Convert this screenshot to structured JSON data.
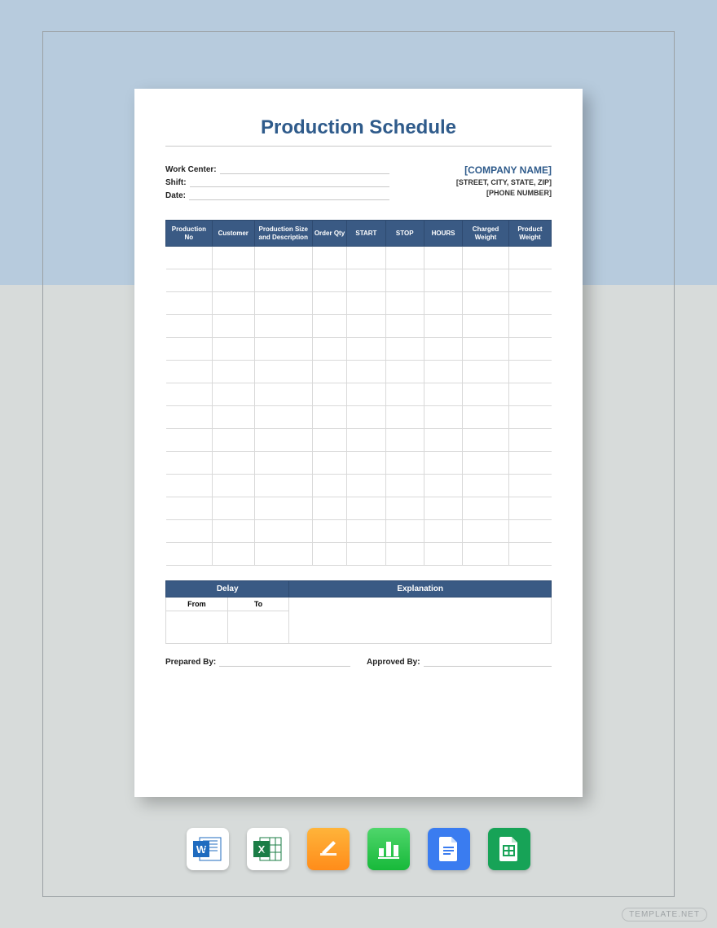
{
  "title": "Production Schedule",
  "header": {
    "left": {
      "work_center_label": "Work Center:",
      "shift_label": "Shift:",
      "date_label": "Date:"
    },
    "right": {
      "company": "[COMPANY NAME]",
      "address": "[STREET, CITY, STATE, ZIP]",
      "phone": "[PHONE NUMBER]"
    }
  },
  "columns": {
    "c0": "Production No",
    "c1": "Customer",
    "c2": "Production Size and Description",
    "c3": "Order Qty",
    "c4": "START",
    "c5": "STOP",
    "c6": "HOURS",
    "c7": "Charged Weight",
    "c8": "Product Weight"
  },
  "delay": {
    "h_delay": "Delay",
    "h_expl": "Explanation",
    "from": "From",
    "to": "To"
  },
  "signoff": {
    "prepared": "Prepared By:",
    "approved": "Approved By:"
  },
  "watermark": "TEMPLATE.NET",
  "icons": {
    "word": "word-icon",
    "excel": "excel-icon",
    "pages": "pages-icon",
    "numbers": "numbers-icon",
    "gdocs": "google-docs-icon",
    "gsheets": "google-sheets-icon"
  }
}
